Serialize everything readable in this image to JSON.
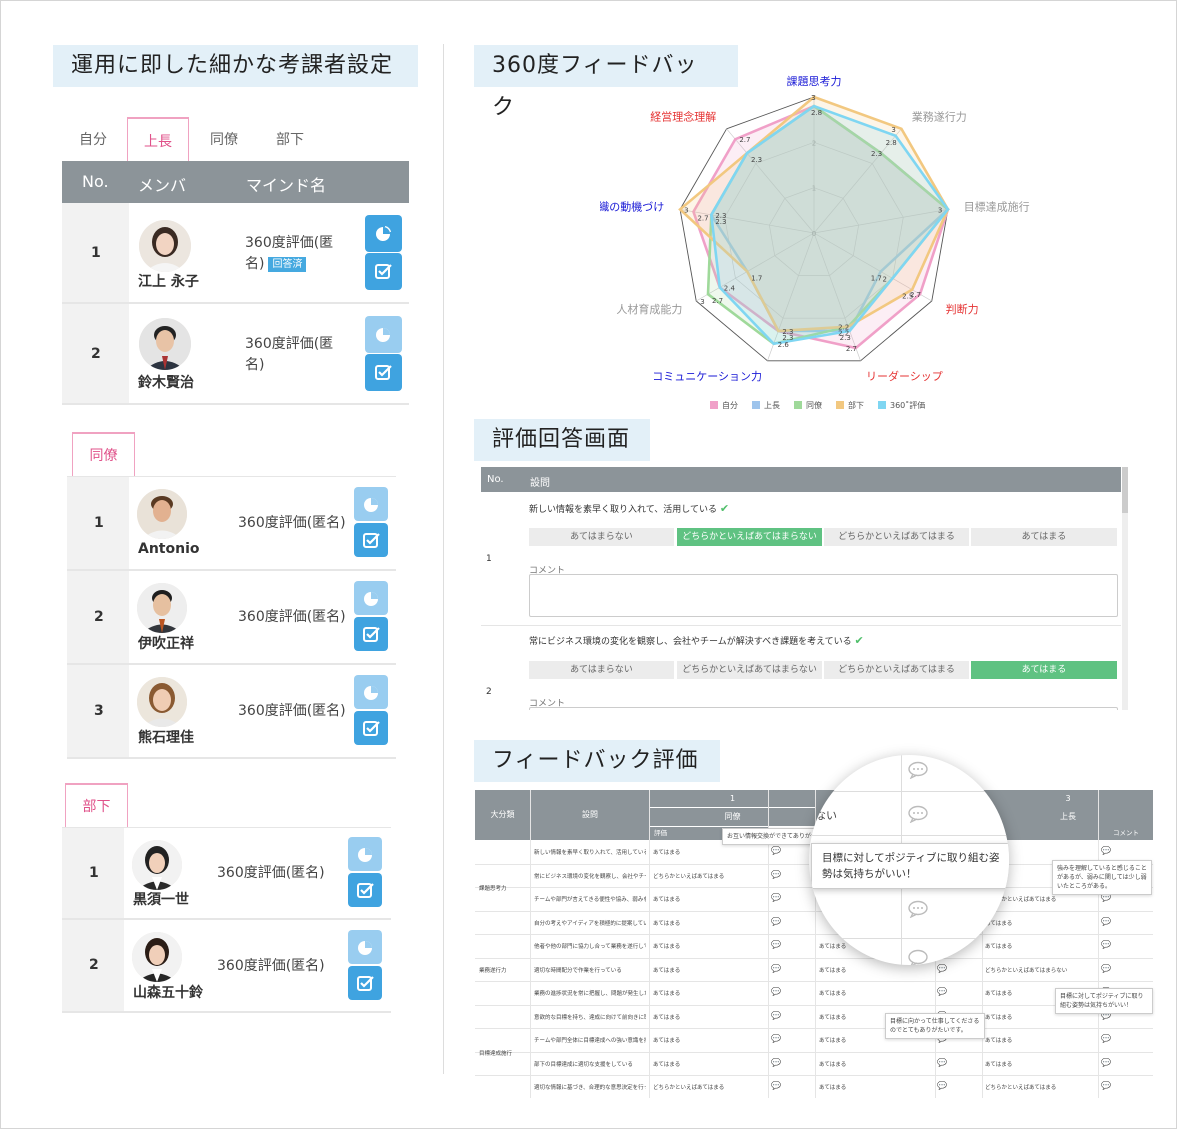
{
  "sections": {
    "left_title": "運用に即した細かな考課者設定",
    "radar_title": "360度フィードバック",
    "eval_title": "評価回答画面",
    "feedback_title": "フィードバック評価"
  },
  "tabs": [
    "自分",
    "上長",
    "同僚",
    "部下"
  ],
  "table_header": {
    "no": "No.",
    "member": "メンバ",
    "mind": "マインド名"
  },
  "boss_rows": [
    {
      "no": "1",
      "name": "江上 永子",
      "survey": "360度評価(匿名)",
      "badge": "回答済"
    },
    {
      "no": "2",
      "name": "鈴木賢治",
      "survey": "360度評価(匿名)"
    }
  ],
  "peer_tab": "同僚",
  "peer_rows": [
    {
      "no": "1",
      "name": "Antonio",
      "survey": "360度評価(匿名)"
    },
    {
      "no": "2",
      "name": "伊吹正祥",
      "survey": "360度評価(匿名)"
    },
    {
      "no": "3",
      "name": "熊石理佳",
      "survey": "360度評価(匿名)"
    }
  ],
  "sub_tab": "部下",
  "sub_rows": [
    {
      "no": "1",
      "name": "黒須一世",
      "survey": "360度評価(匿名)"
    },
    {
      "no": "2",
      "name": "山森五十鈴",
      "survey": "360度評価(匿名)"
    }
  ],
  "chart_data": {
    "type": "radar",
    "axes": [
      "課題思考力",
      "業務遂行力",
      "目標達成施行",
      "判断力",
      "リーダーシップ",
      "コミュニケーション力",
      "人材育成能力",
      "組織の動機づけ",
      "経営理念理解"
    ],
    "axis_colors": [
      "#1a1ad6",
      "#999999",
      "#999999",
      "#e53333",
      "#e53333",
      "#1a1ad6",
      "#999999",
      "#1a1ad6",
      "#e53333"
    ],
    "scale_ticks": [
      "0",
      "1",
      "2",
      "3"
    ],
    "max": 3,
    "series": [
      {
        "name": "自分",
        "color": "#f0a0c8",
        "values": [
          2.8,
          2.3,
          3,
          2.7,
          2.7,
          2.3,
          2.4,
          2.7,
          2.7
        ]
      },
      {
        "name": "上長",
        "color": "#9ec4ec",
        "values": [
          2.8,
          2.3,
          3,
          1.7,
          2.3,
          2.3,
          1.7,
          2.3,
          2.3
        ]
      },
      {
        "name": "同僚",
        "color": "#9fd99a",
        "values": [
          2.8,
          2.3,
          3,
          2,
          2.2,
          2.6,
          2.7,
          2.3,
          2.3
        ]
      },
      {
        "name": "部下",
        "color": "#f2c880",
        "values": [
          3,
          3,
          3,
          2.5,
          2.2,
          2.3,
          1.7,
          3,
          2.3
        ]
      },
      {
        "name": "360˚評価",
        "color": "#7fd6f2",
        "values": [
          2.8,
          2.8,
          3,
          2,
          2.3,
          2.6,
          2.4,
          2.3,
          2.3
        ]
      }
    ],
    "point_labels": [
      [
        "3",
        "2.8"
      ],
      [
        "3",
        "2.8",
        "2.3"
      ],
      [
        "3"
      ],
      [
        "2.7",
        "2.5",
        "2",
        "1.7"
      ],
      [
        "2.7",
        "2.3",
        "2.2",
        "2.2"
      ],
      [
        "2.6",
        "2.3",
        "2.3"
      ],
      [
        "3",
        "2.7",
        "2.4",
        "1.7"
      ],
      [
        "3",
        "2.7",
        "2.3",
        "2.3"
      ],
      [
        "2.7",
        "2.3"
      ]
    ]
  },
  "eval_screen": {
    "header_no": "No.",
    "header_q": "設問",
    "options": [
      "あてはまらない",
      "どちらかといえばあてはまらない",
      "どちらかといえばあてはまる",
      "あてはまる"
    ],
    "comment_label": "コメント",
    "questions": [
      {
        "no": "1",
        "text": "新しい情報を素早く取り入れて、活用している",
        "selected": 1
      },
      {
        "no": "2",
        "text": "常にビジネス環境の変化を観察し、会社やチームが解決すべき課題を考えている",
        "selected": 3
      }
    ]
  },
  "feedback": {
    "headers": {
      "category": "大分類",
      "question": "設問",
      "group1_no": "1",
      "group1_role": "同僚",
      "group3_no": "3",
      "group3_role": "上長",
      "eval": "評価",
      "comment": "コメント"
    },
    "categories": [
      "課題思考力",
      "業務遂行力",
      "目標達成施行"
    ],
    "rows": [
      {
        "q": "新しい情報を素早く取り入れて、活用している",
        "a": "あてはまる",
        "b": "",
        "c": ""
      },
      {
        "q": "常にビジネス環境の変化を観察し、会社やチームが解決すべき課題を考えている",
        "a": "どちらかといえばあてはまる",
        "b": "",
        "c": ""
      },
      {
        "q": "チームや部門が言えてきる便性や協み、弱みを理解している",
        "a": "あてはまる",
        "b": "",
        "c": "どちらかといえばあてはまる"
      },
      {
        "q": "自分の考えやアイディアを積極的に提案している",
        "a": "あてはまる",
        "b": "",
        "c": "あてはまる"
      },
      {
        "q": "他者や他の部門に協力し合って業務を遂行している",
        "a": "あてはまる",
        "b": "あてはまる",
        "c": "あてはまる"
      },
      {
        "q": "適切な時間配分で作業を行っている",
        "a": "あてはまる",
        "b": "あてはまる",
        "c": "どちらかといえばあてはまらない"
      },
      {
        "q": "業務の進捗状況を常に把握し、問題が発生したときにも素早く対処を行っている",
        "a": "あてはまる",
        "b": "あてはまる",
        "c": "あてはまる"
      },
      {
        "q": "意欲的な目標を持ち、達成に向けて前向きに取り組んでいる",
        "a": "あてはまる",
        "b": "あてはまる",
        "c": "あてはまる"
      },
      {
        "q": "チームや部門全体に目標達成への強い意識を持たせている",
        "a": "あてはまる",
        "b": "あてはまる",
        "c": "あてはまる"
      },
      {
        "q": "部下の目標達成に適切な支援をしている",
        "a": "あてはまる",
        "b": "あてはまる",
        "c": "あてはまる"
      },
      {
        "q": "適切な情報に基づき、合理的な意思決定を行っている",
        "a": "どちらかといえばあてはまる",
        "b": "あてはまる",
        "c": "どちらかといえばあてはまる"
      }
    ],
    "tips": {
      "t1": "お互い情報交換ができてありがた",
      "t2": "強みを理解していると感じることがあるが、弱みに関しては少し弱いたところがある。",
      "t3": "目標に対してポジティブに取り組む姿勢は気持ちがいい！",
      "t4": "目標に向かって仕事してくださるのでとてもありがたいです。",
      "mag_tip": "目標に対してポジティブに取り組む姿勢は気持ちがいい！",
      "mag_text": "ない"
    }
  }
}
